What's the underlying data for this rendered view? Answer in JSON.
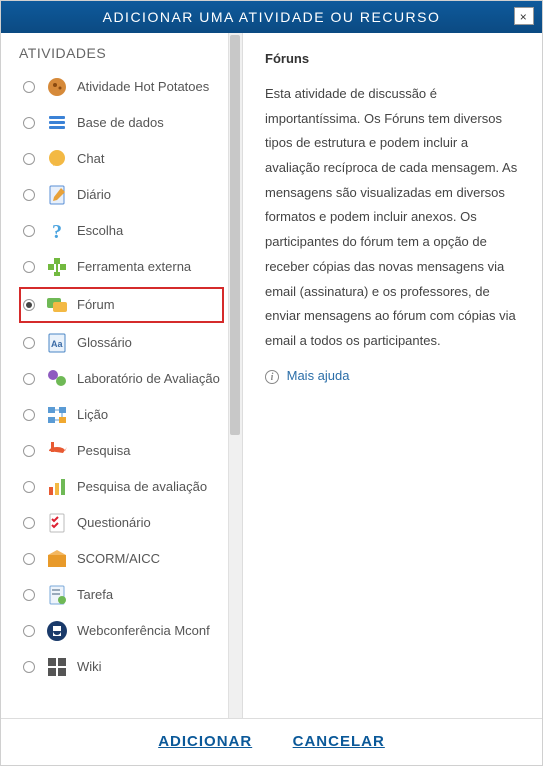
{
  "dialog": {
    "title": "ADICIONAR UMA ATIVIDADE OU RECURSO",
    "close_symbol": "×"
  },
  "left": {
    "heading": "ATIVIDADES",
    "items": [
      {
        "id": "hotpotatoes",
        "label": "Atividade Hot Potatoes",
        "selected": false
      },
      {
        "id": "database",
        "label": "Base de dados",
        "selected": false
      },
      {
        "id": "chat",
        "label": "Chat",
        "selected": false
      },
      {
        "id": "diary",
        "label": "Diário",
        "selected": false
      },
      {
        "id": "choice",
        "label": "Escolha",
        "selected": false
      },
      {
        "id": "lti",
        "label": "Ferramenta externa",
        "selected": false
      },
      {
        "id": "forum",
        "label": "Fórum",
        "selected": true
      },
      {
        "id": "glossary",
        "label": "Glossário",
        "selected": false
      },
      {
        "id": "workshop",
        "label": "Laboratório de Avaliação",
        "selected": false
      },
      {
        "id": "lesson",
        "label": "Lição",
        "selected": false
      },
      {
        "id": "survey",
        "label": "Pesquisa",
        "selected": false
      },
      {
        "id": "feedback",
        "label": "Pesquisa de avaliação",
        "selected": false
      },
      {
        "id": "quiz",
        "label": "Questionário",
        "selected": false
      },
      {
        "id": "scorm",
        "label": "SCORM/AICC",
        "selected": false
      },
      {
        "id": "assign",
        "label": "Tarefa",
        "selected": false
      },
      {
        "id": "mconf",
        "label": "Webconferência Mconf",
        "selected": false
      },
      {
        "id": "wiki",
        "label": "Wiki",
        "selected": false
      }
    ]
  },
  "right": {
    "title": "Fóruns",
    "description": "Esta atividade de discussão é importantíssima. Os Fóruns tem diversos tipos de estrutura e podem incluir a avaliação recíproca de cada mensagem. As mensagens são visualizadas em diversos formatos e podem incluir anexos. Os participantes do fórum tem a opção de receber cópias das novas mensagens via email (assinatura) e os professores, de enviar mensagens ao fórum com cópias via email a todos os participantes.",
    "help_label": "Mais ajuda"
  },
  "footer": {
    "add_label": "ADICIONAR",
    "cancel_label": "CANCELAR"
  }
}
